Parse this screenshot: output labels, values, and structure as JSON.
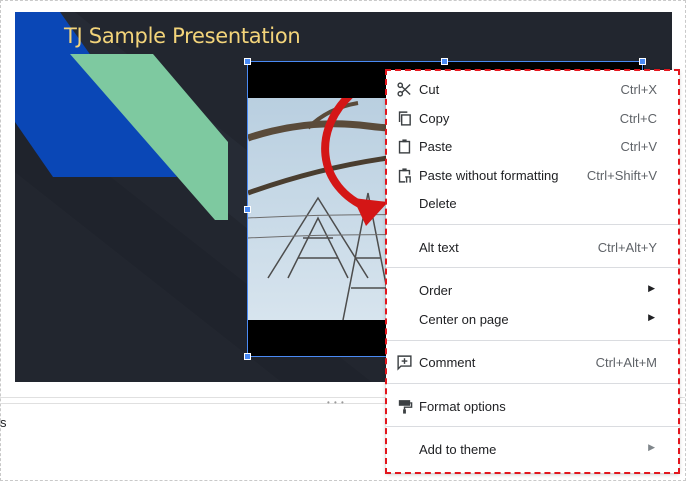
{
  "slide": {
    "title": "TJ Sample Presentation",
    "colors": {
      "background": "#22262f",
      "accent_blue": "#0a47b6",
      "accent_green": "#7ec9a0",
      "title": "#f3d47a"
    }
  },
  "notes": {
    "text": "s"
  },
  "context_menu": {
    "items": [
      {
        "label": "Cut",
        "shortcut": "Ctrl+X",
        "icon": "scissors-icon"
      },
      {
        "label": "Copy",
        "shortcut": "Ctrl+C",
        "icon": "copy-icon"
      },
      {
        "label": "Paste",
        "shortcut": "Ctrl+V",
        "icon": "clipboard-icon"
      },
      {
        "label": "Paste without formatting",
        "shortcut": "Ctrl+Shift+V",
        "icon": "paste-plain-icon"
      },
      {
        "label": "Delete",
        "shortcut": "",
        "icon": ""
      },
      {
        "label": "Alt text",
        "shortcut": "Ctrl+Alt+Y",
        "icon": ""
      },
      {
        "label": "Order",
        "shortcut": "",
        "icon": "",
        "submenu": true
      },
      {
        "label": "Center on page",
        "shortcut": "",
        "icon": "",
        "submenu": true
      },
      {
        "label": "Comment",
        "shortcut": "Ctrl+Alt+M",
        "icon": "add-comment-icon"
      },
      {
        "label": "Format options",
        "shortcut": "",
        "icon": "format-paint-icon"
      },
      {
        "label": "Add to theme",
        "shortcut": "",
        "icon": "",
        "submenu": true
      }
    ],
    "highlight_color": "#e3161d"
  }
}
